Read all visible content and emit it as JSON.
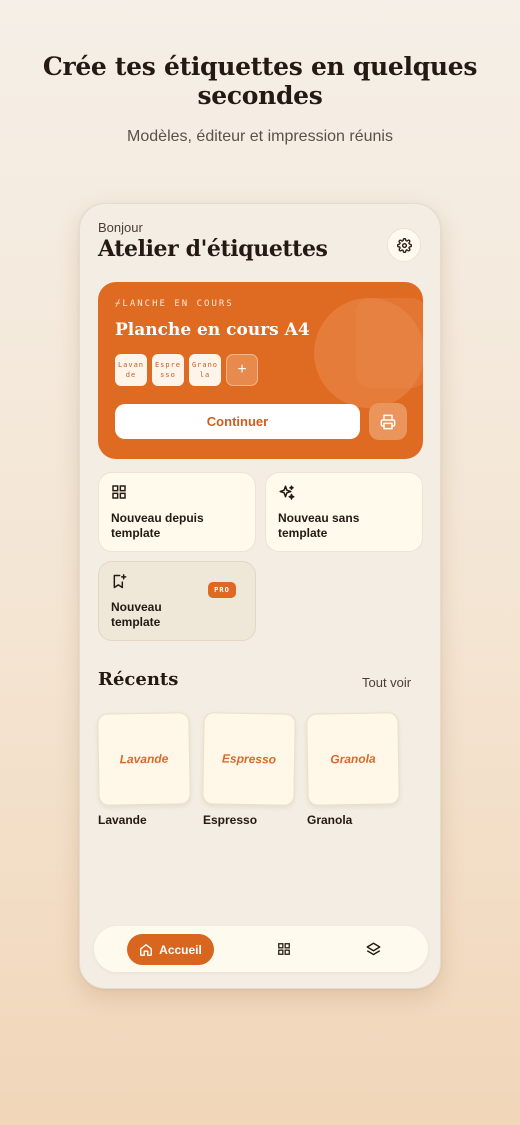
{
  "hero": {
    "title": "Crée tes étiquettes en quelques secondes",
    "subtitle": "Modèles, éditeur et impression réunis"
  },
  "header": {
    "greeting": "Bonjour",
    "title": "Atelier d'étiquettes",
    "settings_icon": "gear-icon"
  },
  "current_sheet": {
    "eyebrow": "⌿LANCHE EN COURS",
    "title": "Planche en cours A4",
    "chips": [
      "Lavande",
      "Espresso",
      "Granola"
    ],
    "add_label": "+",
    "continue_label": "Continuer",
    "print_icon": "printer-icon"
  },
  "actions": [
    {
      "label": "Nouveau depuis template",
      "icon": "grid-icon"
    },
    {
      "label": "Nouveau sans template",
      "icon": "sparkles-icon"
    },
    {
      "label": "Nouveau template",
      "icon": "bookmark-add-icon",
      "badge": "PRO"
    }
  ],
  "recents": {
    "title": "Récents",
    "see_all": "Tout voir",
    "items": [
      {
        "thumb": "Lavande",
        "name": "Lavande"
      },
      {
        "thumb": "Espresso",
        "name": "Espresso"
      },
      {
        "thumb": "Granola",
        "name": "Granola"
      }
    ]
  },
  "tabbar": {
    "home_label": "Accueil",
    "icons": [
      "home-icon",
      "grid-icon",
      "layers-icon"
    ]
  },
  "colors": {
    "accent": "#df6a22",
    "background": "#f3ede3",
    "card_surface": "#fffaec"
  }
}
